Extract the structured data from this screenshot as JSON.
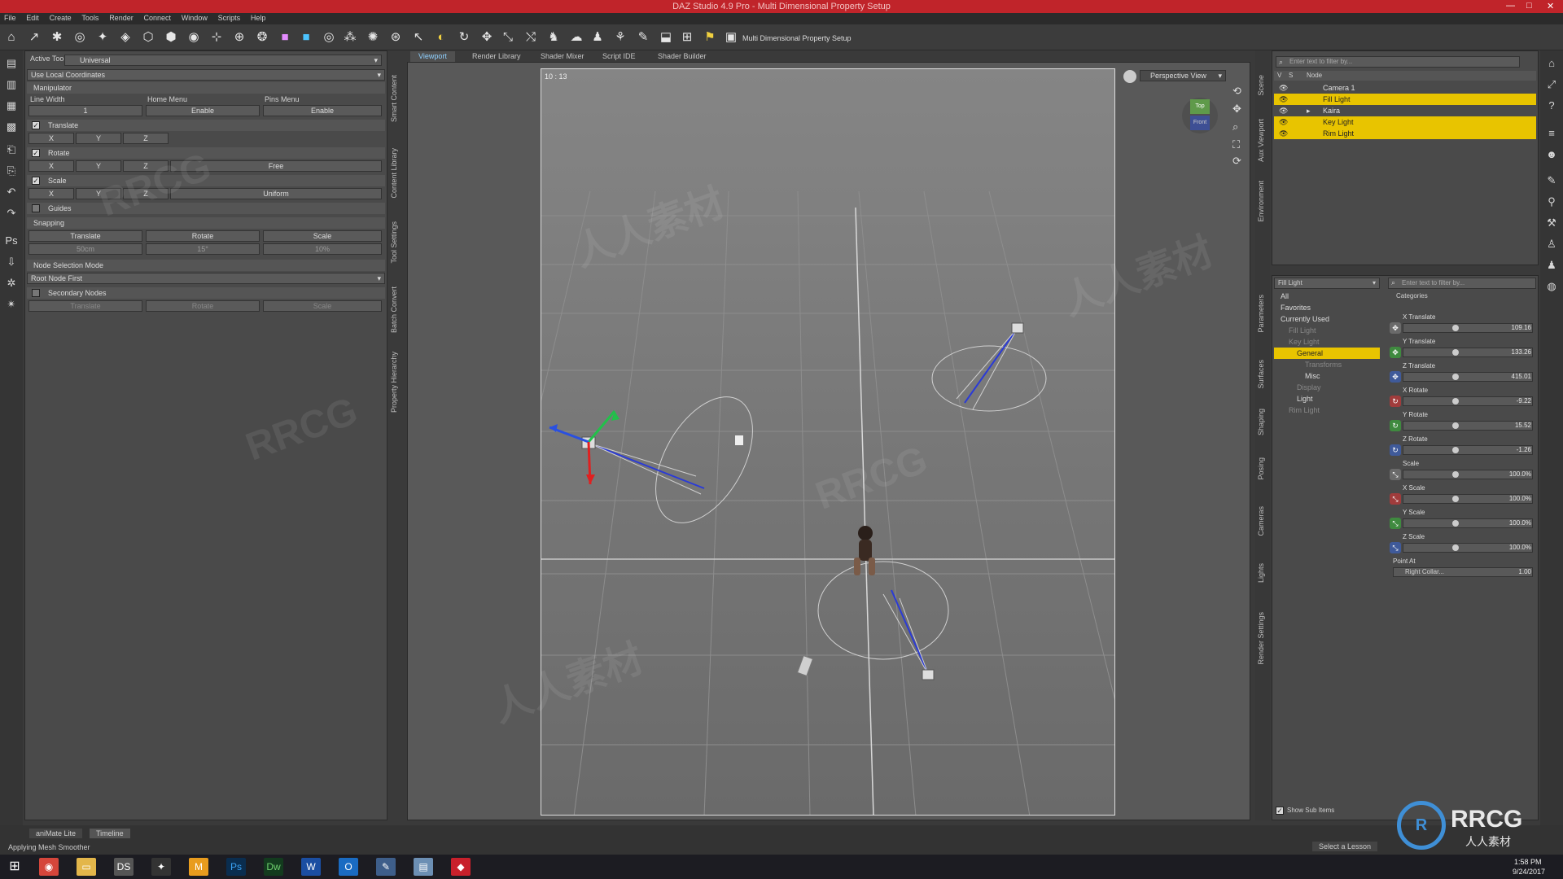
{
  "app": {
    "title": "DAZ Studio 4.9 Pro - Multi Dimensional Property Setup",
    "window_controls": [
      "—",
      "□",
      "✕"
    ],
    "brand_color": "#c0242a"
  },
  "menu": [
    "File",
    "Edit",
    "Create",
    "Tools",
    "Render",
    "Connect",
    "Window",
    "Scripts",
    "Help"
  ],
  "toolbar": {
    "label": "Multi Dimensional Property Setup"
  },
  "tool_panel": {
    "active_tool_label": "Active Tool",
    "active_tool_value": "Universal",
    "coords": "Use Local Coordinates",
    "manipulator": "Manipulator",
    "line_width": "Line Width",
    "home_menu": "Home Menu",
    "pins_menu": "Pins Menu",
    "line_width_value": "1",
    "enable1": "Enable",
    "enable2": "Enable",
    "translate": "Translate",
    "rotate": "Rotate",
    "scale": "Scale",
    "x": "X",
    "y": "Y",
    "z": "Z",
    "free": "Free",
    "uniform": "Uniform",
    "guides": "Guides",
    "snapping": "Snapping",
    "snap_translate": "Translate",
    "snap_rotate": "Rotate",
    "snap_scale": "Scale",
    "snap_t_val": "50cm",
    "snap_r_val": "15°",
    "snap_s_val": "10%",
    "node_selection_mode": "Node Selection Mode",
    "root_node_first": "Root Node First",
    "secondary_nodes": "Secondary Nodes",
    "sec_translate": "Translate",
    "sec_rotate": "Rotate",
    "sec_scale": "Scale"
  },
  "left_vtabs": [
    "Smart Content",
    "Content Library",
    "Tool Settings",
    "Batch Convert",
    "Property Hierarchy"
  ],
  "bottom_tabs": [
    "aniMate Lite",
    "Timeline"
  ],
  "status": "Applying Mesh Smoother",
  "viewport_tabs": [
    "Viewport",
    "Render Library",
    "Shader Mixer",
    "Script IDE",
    "Shader Builder"
  ],
  "viewport": {
    "aspect": "10 : 13",
    "view_label": "Perspective View",
    "cube_top": "Top",
    "cube_front": "Front"
  },
  "right_vtabs": [
    "Scene",
    "Aux Viewport",
    "Environment"
  ],
  "right_vtabs2": [
    "Parameters",
    "Surfaces",
    "Shaping",
    "Posing",
    "Cameras",
    "Lights",
    "Render Settings"
  ],
  "scene": {
    "filter_placeholder": "Enter text to filter by...",
    "header_v": "V",
    "header_s": "S",
    "header_node": "Node",
    "items": [
      {
        "label": "Camera 1",
        "selected": false
      },
      {
        "label": "Fill Light",
        "selected": true
      },
      {
        "label": "Kaira",
        "selected": false
      },
      {
        "label": "Key Light",
        "selected": true
      },
      {
        "label": "Rim Light",
        "selected": true
      }
    ]
  },
  "params": {
    "node_select": "Fill Light",
    "filter_placeholder": "Enter text to filter by...",
    "categories_header": "Categories",
    "tree": [
      {
        "label": "All",
        "selected": false
      },
      {
        "label": "Favorites",
        "selected": false
      },
      {
        "label": "Currently Used",
        "selected": false
      },
      {
        "label": "Fill Light",
        "selected": false
      },
      {
        "label": "Key Light",
        "selected": false
      },
      {
        "label": "General",
        "selected": true
      },
      {
        "label": "Transforms",
        "selected": false
      },
      {
        "label": "Misc",
        "selected": false
      },
      {
        "label": "Display",
        "selected": false
      },
      {
        "label": "Light",
        "selected": false
      },
      {
        "label": "Rim Light",
        "selected": false
      }
    ],
    "sliders": [
      {
        "label": "X Translate",
        "value": "109.16"
      },
      {
        "label": "Y Translate",
        "value": "133.26"
      },
      {
        "label": "Z Translate",
        "value": "415.01"
      },
      {
        "label": "X Rotate",
        "value": "-9.22"
      },
      {
        "label": "Y Rotate",
        "value": "15.52"
      },
      {
        "label": "Z Rotate",
        "value": "-1.26"
      },
      {
        "label": "Scale",
        "value": "100.0%"
      },
      {
        "label": "X Scale",
        "value": "100.0%"
      },
      {
        "label": "Y Scale",
        "value": "100.0%"
      },
      {
        "label": "Z Scale",
        "value": "100.0%"
      }
    ],
    "point_at_label": "Point At",
    "point_at_value": "Right Collar...",
    "point_at_num": "1.00",
    "show_sub_items": "Show Sub Items"
  },
  "bottom_right": {
    "lesson": "Select a Lesson"
  },
  "tray": {
    "time": "1:58 PM",
    "date": "9/24/2017"
  },
  "watermark": {
    "brand": "RRCG",
    "sub": "人人素材",
    "big": "RRCG"
  }
}
